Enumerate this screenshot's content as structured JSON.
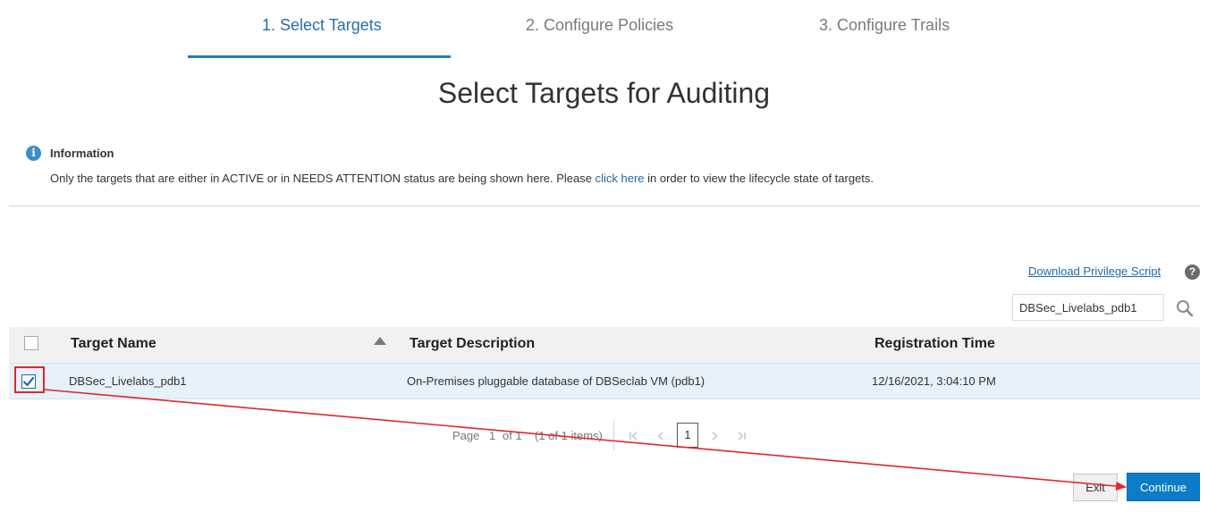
{
  "wizard": {
    "steps": [
      {
        "label": "1. Select Targets"
      },
      {
        "label": "2. Configure Policies"
      },
      {
        "label": "3. Configure Trails"
      }
    ],
    "active_step": 1
  },
  "page_title": "Select Targets for Auditing",
  "info": {
    "title": "Information",
    "text_before": "Only the targets that are either in ACTIVE or in NEEDS ATTENTION status are being shown here. Please ",
    "link_text": "click here",
    "text_after": " in order to view the lifecycle state of targets."
  },
  "toolbar": {
    "download_link": "Download Privilege Script",
    "help_symbol": "?",
    "search_value": "DBSec_Livelabs_pdb1"
  },
  "table": {
    "columns": [
      "Target Name",
      "Target Description",
      "Registration Time"
    ],
    "sort_column": "Target Name",
    "rows": [
      {
        "checked": true,
        "name": "DBSec_Livelabs_pdb1",
        "description": "On-Premises pluggable database of DBSeclab VM (pdb1)",
        "registration_time": "12/16/2021, 3:04:10 PM"
      }
    ]
  },
  "pagination": {
    "page_label": "Page",
    "page_number": "1",
    "of_label": "of 1",
    "items_summary": "(1 of 1 items)",
    "current": "1"
  },
  "buttons": {
    "exit": "Exit",
    "continue": "Continue"
  },
  "colors": {
    "accent": "#2a7bb8",
    "row_selected": "#e6f1fa",
    "annotation": "#e32626",
    "continue_button": "#0c7cc7"
  }
}
